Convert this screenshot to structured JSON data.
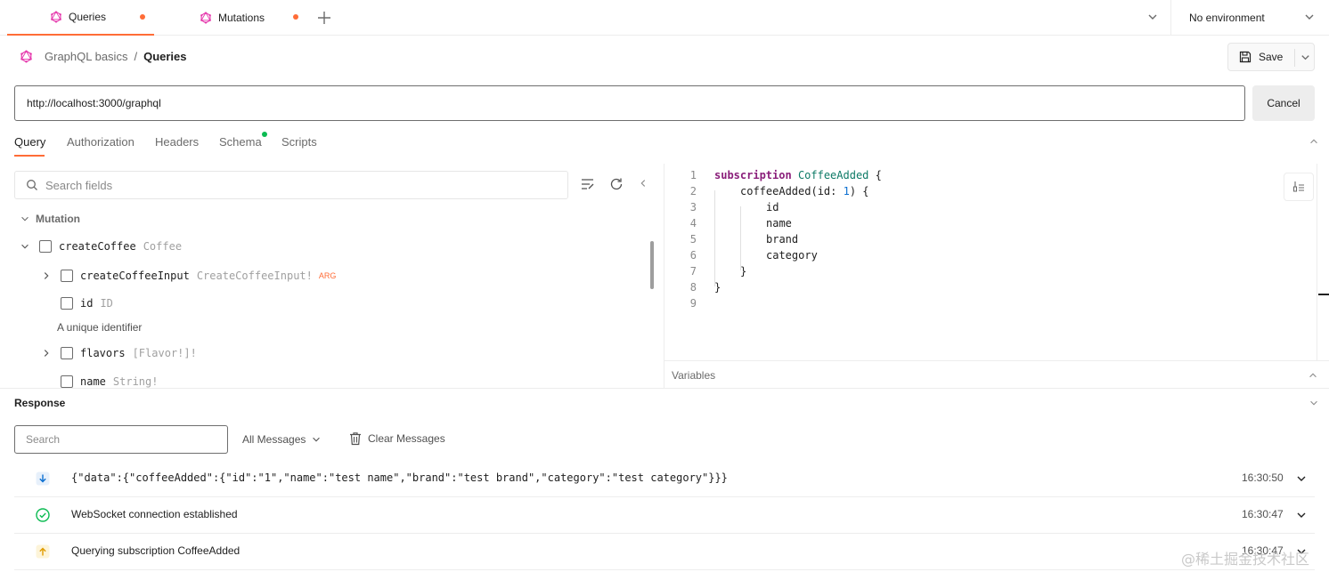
{
  "tabs": [
    {
      "label": "Queries",
      "active": true
    },
    {
      "label": "Mutations",
      "active": false
    }
  ],
  "environment": {
    "label": "No environment"
  },
  "breadcrumb": {
    "collection": "GraphQL basics",
    "separator": "/",
    "current": "Queries"
  },
  "save_label": "Save",
  "url": {
    "value": "http://localhost:3000/graphql",
    "cancel_label": "Cancel"
  },
  "subtabs": [
    "Query",
    "Authorization",
    "Headers",
    "Schema",
    "Scripts"
  ],
  "explorer": {
    "search_placeholder": "Search fields",
    "section": "Mutation",
    "root_field": {
      "name": "createCoffee",
      "type": "Coffee"
    },
    "fields": [
      {
        "name": "createCoffeeInput",
        "type": "CreateCoffeeInput!",
        "badge": "ARG"
      },
      {
        "name": "id",
        "type": "ID",
        "description": "A unique identifier"
      },
      {
        "name": "flavors",
        "type": "[Flavor!]!"
      },
      {
        "name": "name",
        "type": "String!"
      }
    ]
  },
  "editor": {
    "line_numbers": [
      "1",
      "2",
      "3",
      "4",
      "5",
      "6",
      "7",
      "8",
      "9"
    ],
    "lines": [
      {
        "kw": "subscription",
        "name": "CoffeeAdded",
        "rest": " {"
      },
      {
        "field": "coffeeAdded",
        "args_open": "(id: ",
        "num": "1",
        "args_close": ") {"
      },
      {
        "text": "id"
      },
      {
        "text": "name"
      },
      {
        "text": "brand"
      },
      {
        "text": "category"
      },
      {
        "text": "}"
      },
      {
        "text": "}"
      },
      {
        "text": ""
      }
    ]
  },
  "variables_label": "Variables",
  "response": {
    "title": "Response",
    "search_placeholder": "Search",
    "filter_label": "All Messages",
    "clear_label": "Clear Messages",
    "messages": [
      {
        "text": "{\"data\":{\"coffeeAdded\":{\"id\":\"1\",\"name\":\"test name\",\"brand\":\"test brand\",\"category\":\"test category\"}}}",
        "time": "16:30:50",
        "icon": "arrow-down-icon"
      },
      {
        "text": "WebSocket connection established",
        "time": "16:30:47",
        "icon": "check-circle-icon"
      },
      {
        "text": "Querying subscription CoffeeAdded",
        "time": "16:30:47",
        "icon": "arrow-up-icon"
      }
    ]
  },
  "watermark": "@稀土掘金技术社区",
  "colors": {
    "accent": "#ff6c37",
    "graphql": "#e535ab",
    "success": "#0cbb52",
    "info": "#0b6fd1",
    "warning": "#f2a900"
  }
}
